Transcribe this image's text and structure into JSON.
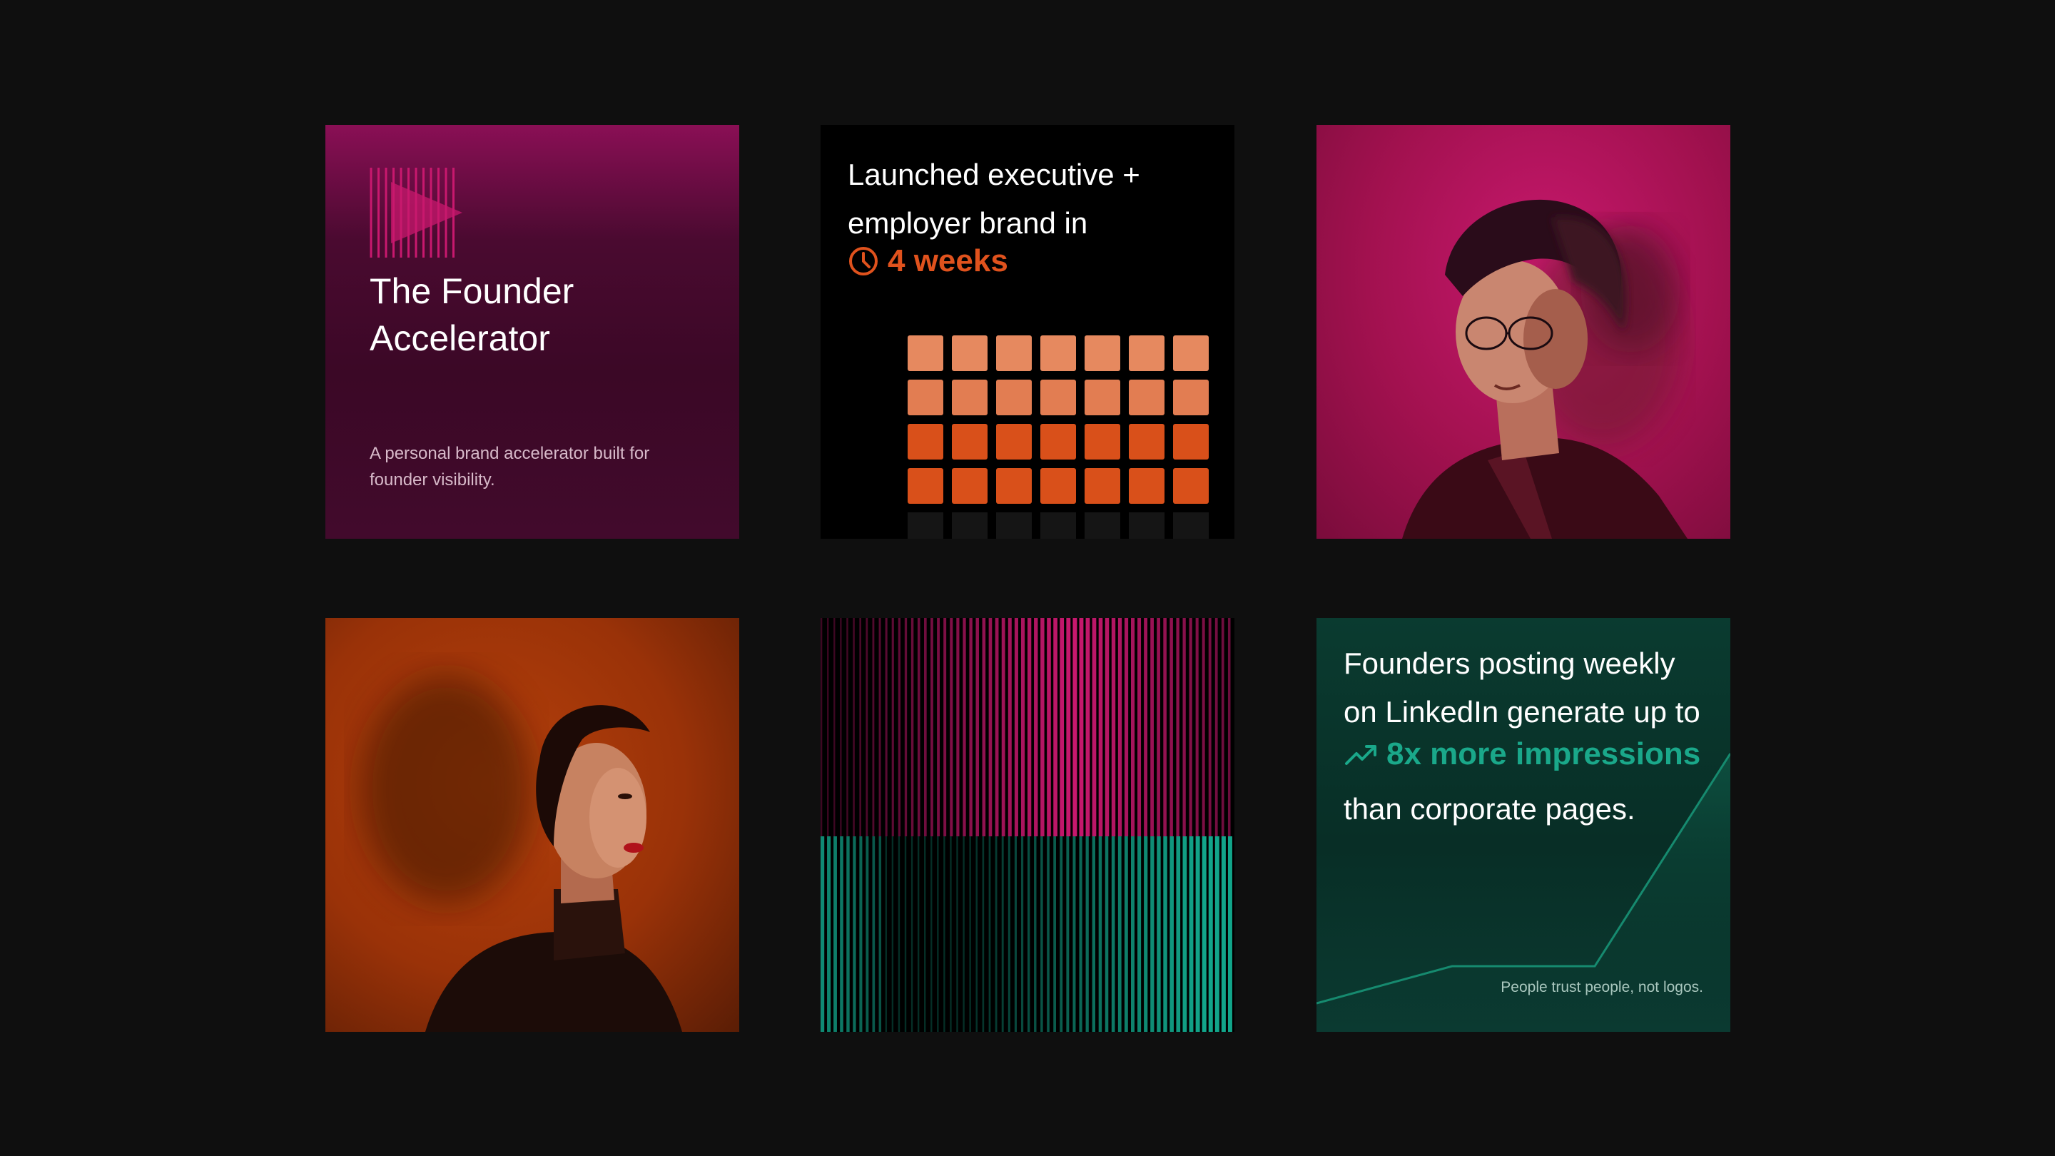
{
  "cards": {
    "founder": {
      "title_line1": "The Founder",
      "title_line2": "Accelerator",
      "description": "A personal brand accelerator built for founder visibility."
    },
    "launch": {
      "line1": "Launched executive +",
      "line2": "employer brand in",
      "highlight": "4 weeks",
      "icon": "clock-icon"
    },
    "portrait_man": {
      "alt": "portrait"
    },
    "portrait_woman": {
      "alt": "portrait"
    },
    "stat": {
      "line1": "Founders posting weekly",
      "line2": "on LinkedIn generate up to",
      "highlight": "8x more impressions",
      "line4": "than corporate pages.",
      "footnote": "People trust people, not logos.",
      "icon": "trend-up-icon"
    }
  },
  "colors": {
    "background": "#0f0f0f",
    "magenta": "#c8186e",
    "orange": "#e0521d",
    "teal": "#1aa88a"
  }
}
